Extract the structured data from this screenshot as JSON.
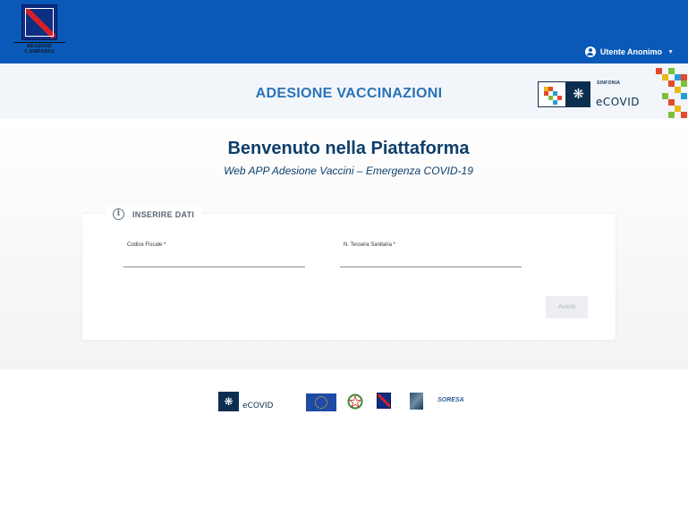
{
  "header": {
    "user_label": "Utente Anonimo",
    "user_icon": "user-avatar-icon",
    "caret_icon": "chevron-down-icon"
  },
  "banner": {
    "region_caption": "REGIONE CAMPANIA",
    "app_title": "ADESIONE VACCINAZIONI",
    "sinfonia_label": "SINFONIA",
    "ecovid_label": "eCOVID"
  },
  "hero": {
    "welcome": "Benvenuto nella Piattaforma",
    "subtitle": "Web APP Adesione Vaccini – Emergenza COVID-19"
  },
  "form": {
    "section_title": "INSERIRE DATI",
    "codice_fiscale": {
      "label": "Codice Fiscale *",
      "value": "",
      "placeholder": ""
    },
    "tessera": {
      "label": "N. Tessera Sanitaria *",
      "value": "",
      "placeholder": ""
    },
    "submit_label": "Avanti"
  },
  "footer": {
    "ecovid_text": "eCOVID",
    "soresa_text": "SORESA"
  },
  "colors": {
    "topbar": "#0a59b8",
    "title_blue": "#2a73b6",
    "heading_navy": "#0e3f6b",
    "brand_dark": "#0d2f4f"
  }
}
